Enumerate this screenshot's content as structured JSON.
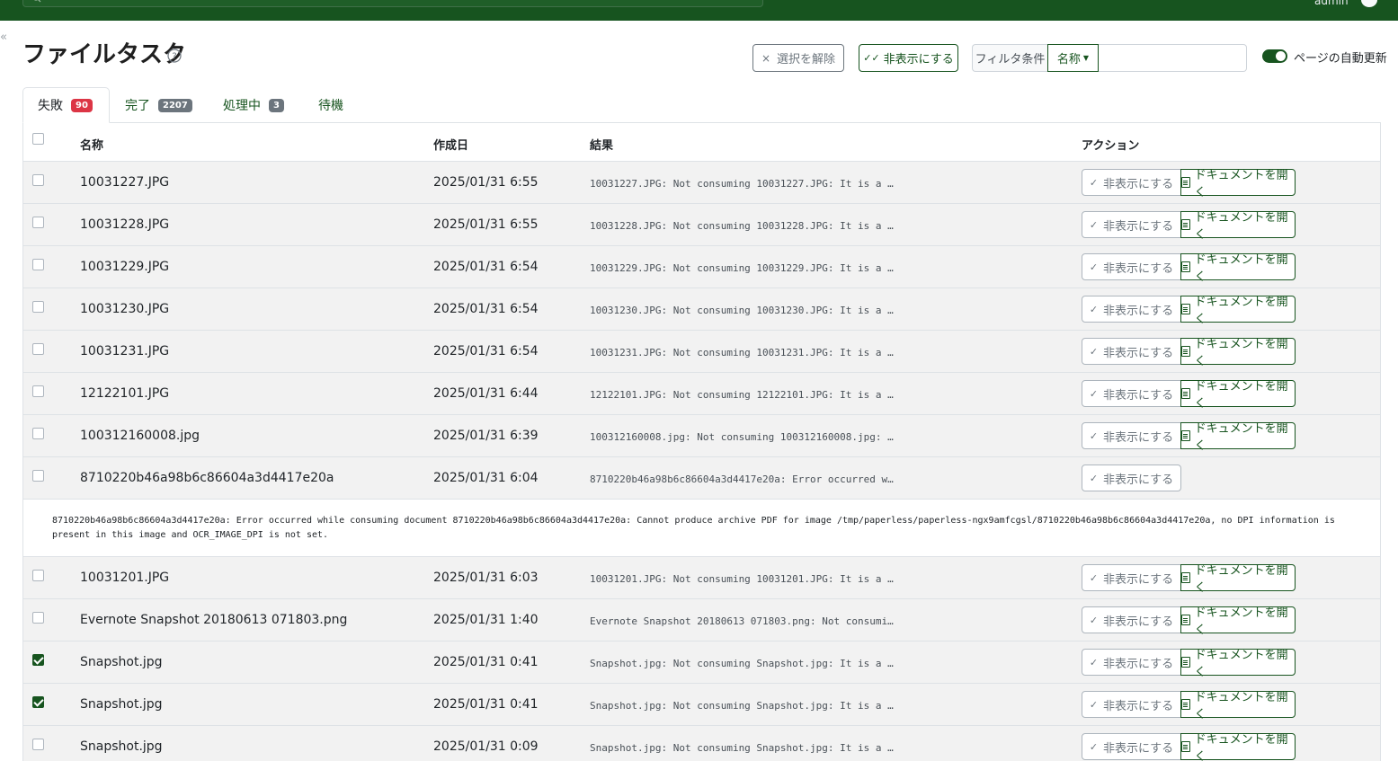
{
  "header": {
    "search_placeholder": "Search",
    "user": "admin"
  },
  "page": {
    "title": "ファイルタスク"
  },
  "toolbar": {
    "clear_selection": "選択を解除",
    "hide_selected": "非表示にする",
    "filter_label": "フィルタ条件",
    "filter_field": "名称",
    "filter_value": "",
    "auto_refresh_label": "ページの自動更新",
    "auto_refresh_on": true
  },
  "tabs": [
    {
      "label": "失敗",
      "count": "90",
      "active": true
    },
    {
      "label": "完了",
      "count": "2207",
      "active": false
    },
    {
      "label": "処理中",
      "count": "3",
      "active": false
    },
    {
      "label": "待機",
      "count": "",
      "active": false
    }
  ],
  "table": {
    "columns": {
      "name": "名称",
      "created": "作成日",
      "result": "結果",
      "actions": "アクション"
    },
    "hide_label": "非表示にする",
    "open_label": "ドキュメントを開く",
    "rows": [
      {
        "name": "10031227.JPG",
        "created": "2025/01/31 6:55",
        "result": "10031227.JPG: Not consuming 10031227.JPG: It is a …",
        "checked": false,
        "has_open": true
      },
      {
        "name": "10031228.JPG",
        "created": "2025/01/31 6:55",
        "result": "10031228.JPG: Not consuming 10031228.JPG: It is a …",
        "checked": false,
        "has_open": true
      },
      {
        "name": "10031229.JPG",
        "created": "2025/01/31 6:54",
        "result": "10031229.JPG: Not consuming 10031229.JPG: It is a …",
        "checked": false,
        "has_open": true
      },
      {
        "name": "10031230.JPG",
        "created": "2025/01/31 6:54",
        "result": "10031230.JPG: Not consuming 10031230.JPG: It is a …",
        "checked": false,
        "has_open": true
      },
      {
        "name": "10031231.JPG",
        "created": "2025/01/31 6:54",
        "result": "10031231.JPG: Not consuming 10031231.JPG: It is a …",
        "checked": false,
        "has_open": true
      },
      {
        "name": "12122101.JPG",
        "created": "2025/01/31 6:44",
        "result": "12122101.JPG: Not consuming 12122101.JPG: It is a …",
        "checked": false,
        "has_open": true
      },
      {
        "name": "100312160008.jpg",
        "created": "2025/01/31 6:39",
        "result": "100312160008.jpg: Not consuming 100312160008.jpg: …",
        "checked": false,
        "has_open": true
      },
      {
        "name": "8710220b46a98b6c86604a3d4417e20a",
        "created": "2025/01/31 6:04",
        "result": "8710220b46a98b6c86604a3d4417e20a: Error occurred w…",
        "checked": false,
        "has_open": false
      },
      {
        "name": "10031201.JPG",
        "created": "2025/01/31 6:03",
        "result": "10031201.JPG: Not consuming 10031201.JPG: It is a …",
        "checked": false,
        "has_open": true
      },
      {
        "name": "Evernote Snapshot 20180613 071803.png",
        "created": "2025/01/31 1:40",
        "result": "Evernote Snapshot 20180613 071803.png: Not consumi…",
        "checked": false,
        "has_open": true
      },
      {
        "name": "Snapshot.jpg",
        "created": "2025/01/31 0:41",
        "result": "Snapshot.jpg: Not consuming Snapshot.jpg: It is a …",
        "checked": true,
        "has_open": true
      },
      {
        "name": "Snapshot.jpg",
        "created": "2025/01/31 0:41",
        "result": "Snapshot.jpg: Not consuming Snapshot.jpg: It is a …",
        "checked": true,
        "has_open": true
      },
      {
        "name": "Snapshot.jpg",
        "created": "2025/01/31 0:09",
        "result": "Snapshot.jpg: Not consuming Snapshot.jpg: It is a …",
        "checked": false,
        "has_open": true
      }
    ],
    "expanded_detail": "8710220b46a98b6c86604a3d4417e20a: Error occurred while consuming document 8710220b46a98b6c86604a3d4417e20a: Cannot produce archive PDF for image /tmp/paperless/paperless-ngx9amfcgsl/8710220b46a98b6c86604a3d4417e20a, no DPI information is present in this image and OCR_IMAGE_DPI is not set."
  },
  "colors": {
    "brand": "#17541f",
    "danger": "#dc3545",
    "muted": "#6c757d"
  }
}
